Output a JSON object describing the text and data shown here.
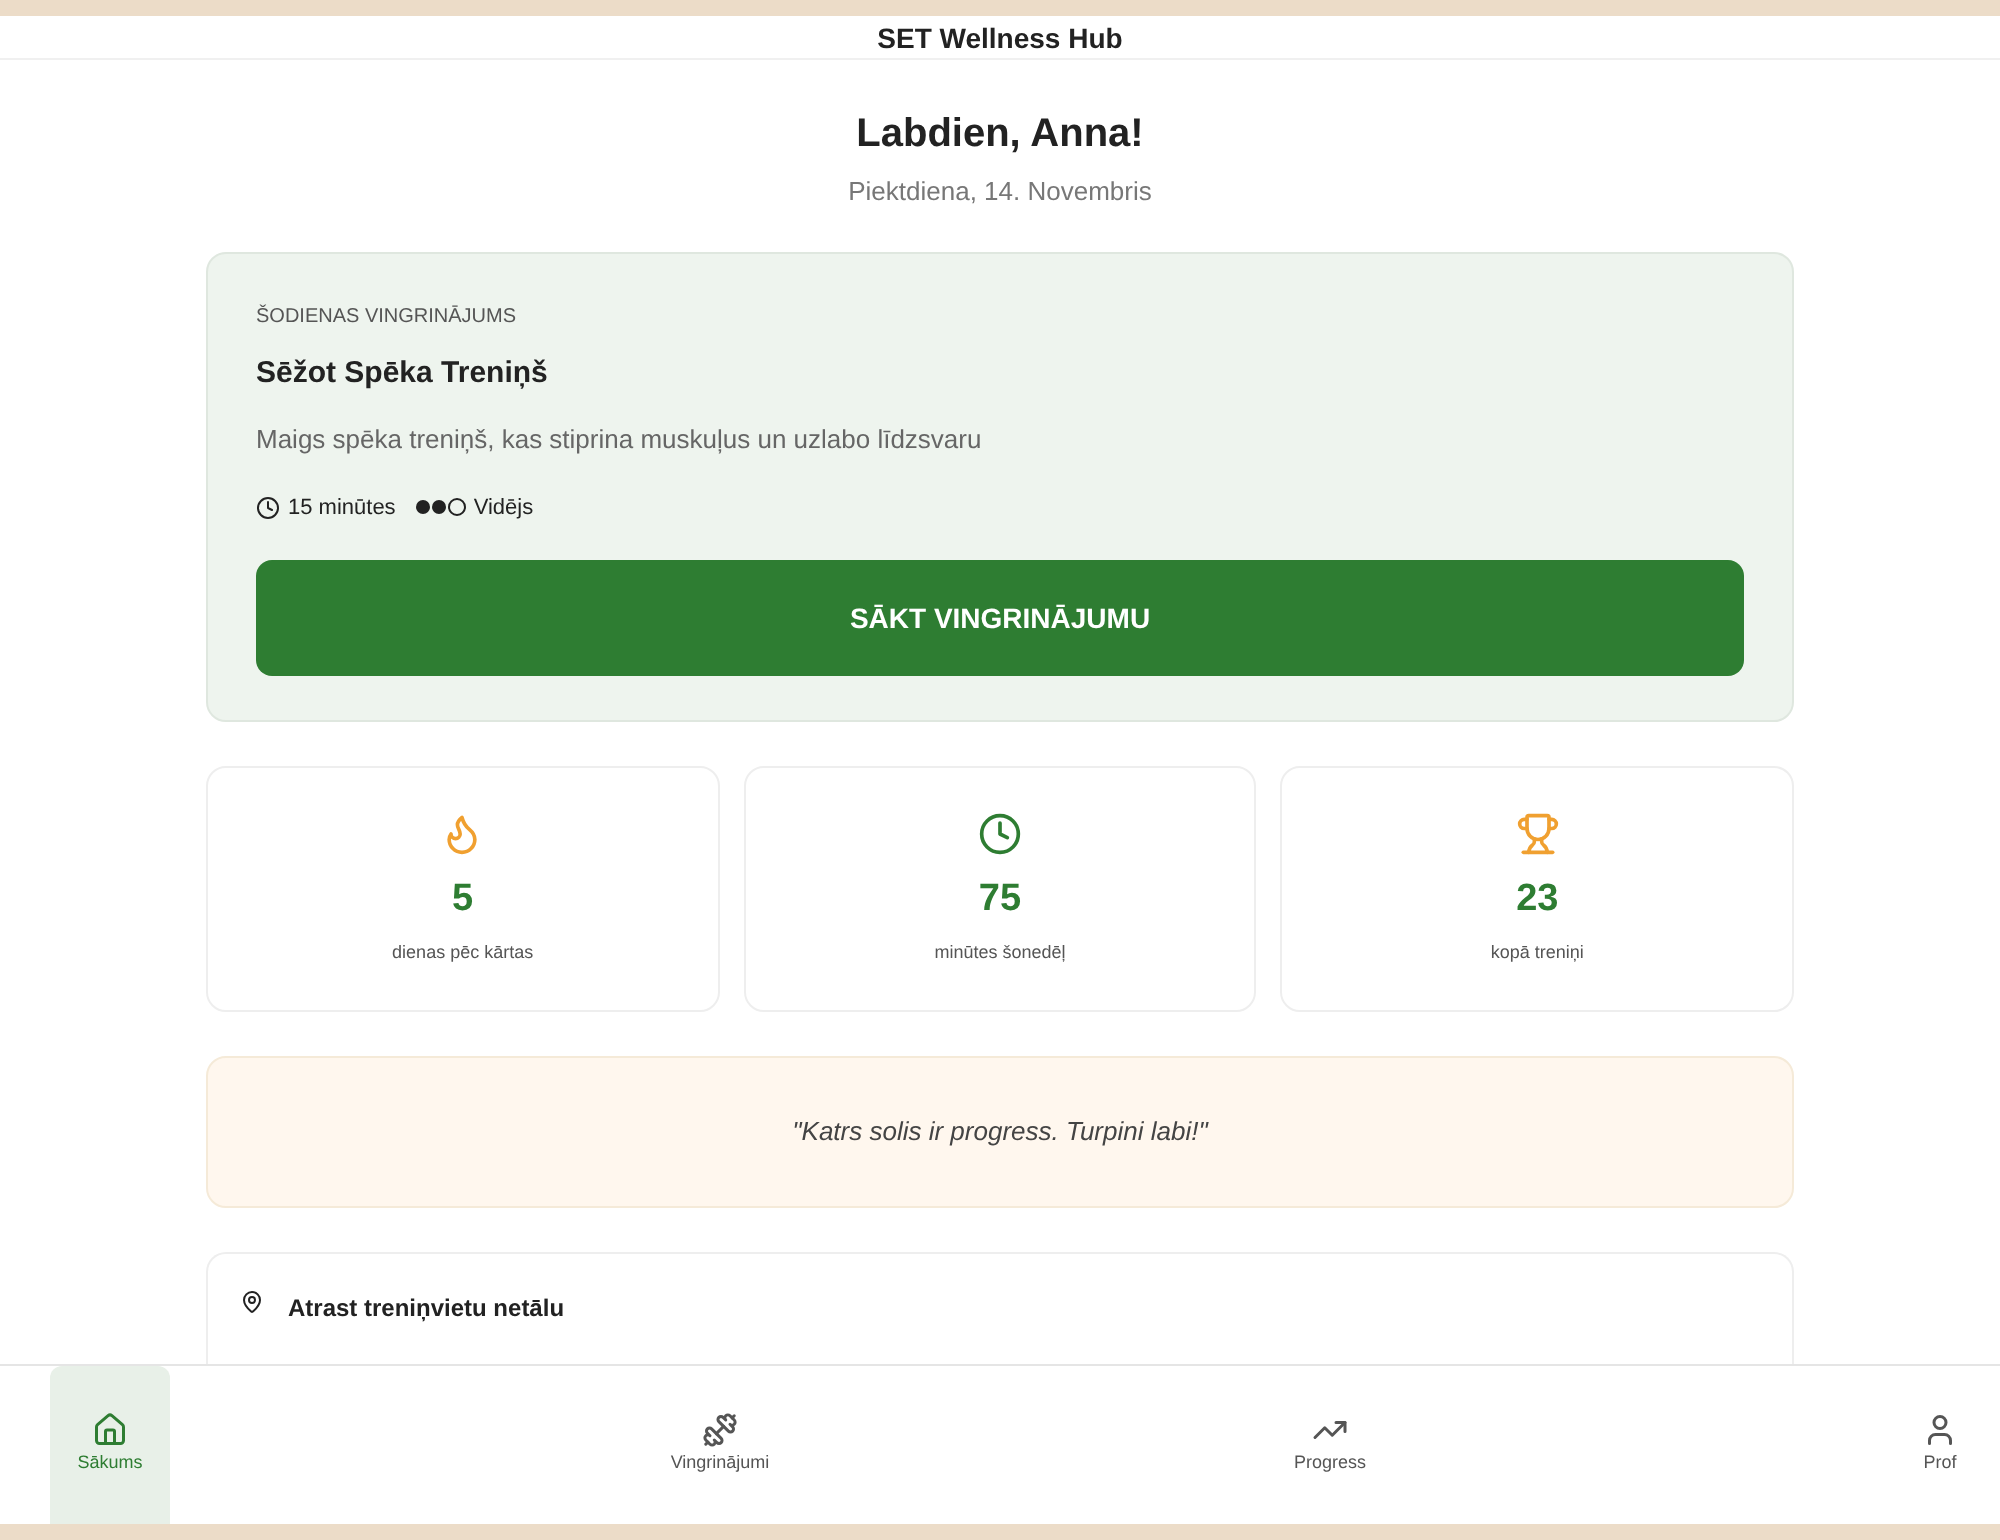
{
  "header": {
    "title": "SET Wellness Hub"
  },
  "greeting": {
    "title": "Labdien, Anna!",
    "date": "Piektdiena, 14. Novembris"
  },
  "workout": {
    "eyebrow": "ŠODIENAS VINGRINĀJUMS",
    "title": "Sēžot Spēka Treniņš",
    "description": "Maigs spēka treniņš, kas stiprina muskuļus un uzlabo līdzsvaru",
    "duration": "15 minūtes",
    "difficulty": {
      "stars": 2,
      "label": "Vidējs"
    },
    "button": "SĀKT VINGRINĀJUMU"
  },
  "stats": [
    {
      "kind": "flame",
      "value": "5",
      "label": "dienas pēc kārtas",
      "color": "#f0a030"
    },
    {
      "kind": "clock",
      "value": "75",
      "label": "minūtes šonedēļ",
      "color": "#2e7d32"
    },
    {
      "kind": "trophy",
      "value": "23",
      "label": "kopā treniņi",
      "color": "#f0a030"
    }
  ],
  "quote": "\"Katrs solis ir progress. Turpini labi!\"",
  "location": {
    "label": "Atrast treniņvietu netālu"
  },
  "nav": [
    {
      "kind": "home",
      "label": "Sākums",
      "selected": true
    },
    {
      "kind": "exercise",
      "label": "Vingrinājumi",
      "selected": false
    },
    {
      "kind": "progress",
      "label": "Progress",
      "selected": false
    },
    {
      "kind": "profile",
      "label": "Prof",
      "selected": false
    }
  ]
}
